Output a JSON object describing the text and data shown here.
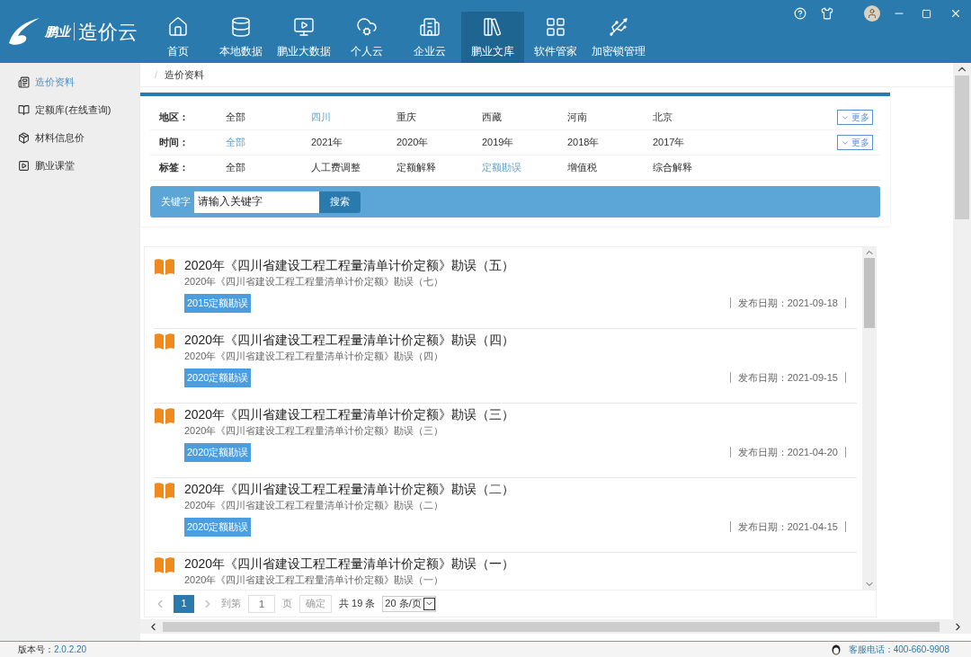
{
  "logo": {
    "brand": "鹏业",
    "product": "造价云"
  },
  "nav": [
    {
      "label": "首页",
      "selected": false
    },
    {
      "label": "本地数据",
      "selected": false
    },
    {
      "label": "鹏业大数据",
      "selected": false
    },
    {
      "label": "个人云",
      "selected": false
    },
    {
      "label": "企业云",
      "selected": false
    },
    {
      "label": "鹏业文库",
      "selected": true
    },
    {
      "label": "软件管家",
      "selected": false
    },
    {
      "label": "加密锁管理",
      "selected": false
    }
  ],
  "sidebar": {
    "items": [
      {
        "label": "造价资料",
        "selected": true
      },
      {
        "label": "定额库(在线查询)",
        "selected": false
      },
      {
        "label": "材料信息价",
        "selected": false
      },
      {
        "label": "鹏业课堂",
        "selected": false
      }
    ]
  },
  "breadcrumb": {
    "separator": "/",
    "current": "造价资料"
  },
  "filters": [
    {
      "label": "地区：",
      "more": "更多",
      "options": [
        {
          "text": "全部",
          "selected": false
        },
        {
          "text": "四川",
          "selected": true
        },
        {
          "text": "重庆",
          "selected": false
        },
        {
          "text": "西藏",
          "selected": false
        },
        {
          "text": "河南",
          "selected": false
        },
        {
          "text": "北京",
          "selected": false
        }
      ]
    },
    {
      "label": "时间：",
      "more": "更多",
      "options": [
        {
          "text": "全部",
          "selected": true
        },
        {
          "text": "2021年",
          "selected": false
        },
        {
          "text": "2020年",
          "selected": false
        },
        {
          "text": "2019年",
          "selected": false
        },
        {
          "text": "2018年",
          "selected": false
        },
        {
          "text": "2017年",
          "selected": false
        }
      ]
    },
    {
      "label": "标签：",
      "options": [
        {
          "text": "全部",
          "selected": false
        },
        {
          "text": "人工费调整",
          "selected": false
        },
        {
          "text": "定额解释",
          "selected": false
        },
        {
          "text": "定额勘误",
          "selected": true
        },
        {
          "text": "增值税",
          "selected": false
        },
        {
          "text": "综合解释",
          "selected": false
        }
      ]
    }
  ],
  "search": {
    "label": "关键字",
    "value": "请输入关键字",
    "button": "搜索"
  },
  "documents": [
    {
      "title": "2020年《四川省建设工程工程量清单计价定额》勘误（五）",
      "subtitle": "2020年《四川省建设工程工程量清单计价定额》勘误（七）",
      "tag": "2015定额勘误",
      "date": "发布日期：2021-09-18"
    },
    {
      "title": "2020年《四川省建设工程工程量清单计价定额》勘误（四）",
      "subtitle": "2020年《四川省建设工程工程量清单计价定额》勘误（四）",
      "tag": "2020定额勘误",
      "date": "发布日期：2021-09-15"
    },
    {
      "title": "2020年《四川省建设工程工程量清单计价定额》勘误（三）",
      "subtitle": "2020年《四川省建设工程工程量清单计价定额》勘误（三）",
      "tag": "2020定额勘误",
      "date": "发布日期：2021-04-20"
    },
    {
      "title": "2020年《四川省建设工程工程量清单计价定额》勘误（二）",
      "subtitle": "2020年《四川省建设工程工程量清单计价定额》勘误（二）",
      "tag": "2020定额勘误",
      "date": "发布日期：2021-04-15"
    },
    {
      "title": "2020年《四川省建设工程工程量清单计价定额》勘误（一）",
      "subtitle": "2020年《四川省建设工程工程量清单计价定额》勘误（一）"
    }
  ],
  "pagination": {
    "pages": [
      {
        "label": "1",
        "selected": true
      }
    ],
    "goto_label": "到第",
    "goto_value": "1",
    "page_unit": "页",
    "confirm": "确定",
    "total": "共 19 条",
    "page_size": "20 条/页"
  },
  "status_bar": {
    "version_label": "版本号：",
    "version": "2.0.2.20",
    "hotline": "客服电话：400-660-9908"
  }
}
